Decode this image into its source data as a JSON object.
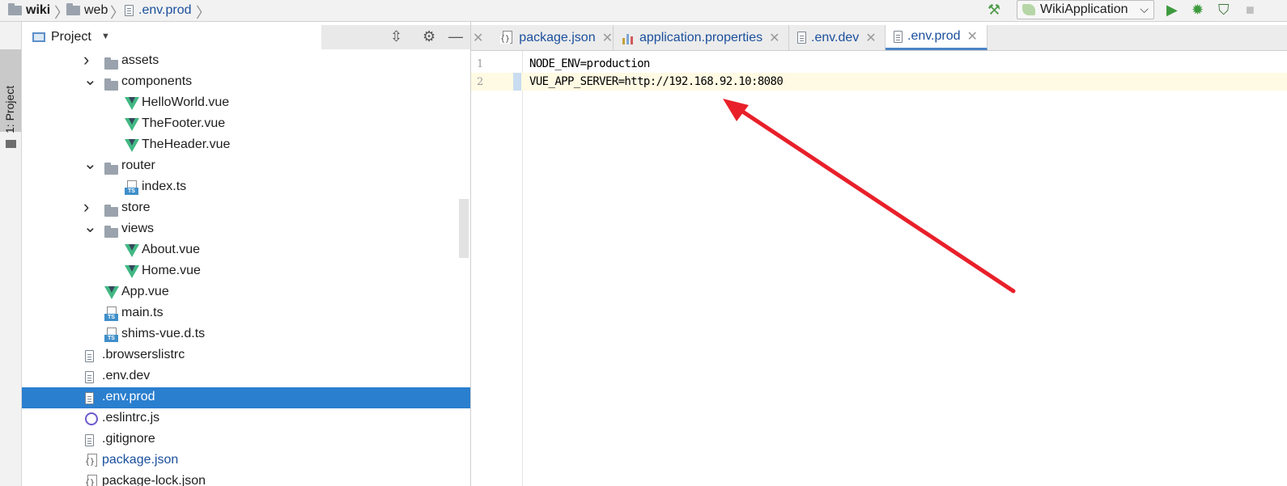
{
  "breadcrumbs": [
    {
      "label": "wiki",
      "icon": "folder-icon"
    },
    {
      "label": "web",
      "icon": "folder-icon"
    },
    {
      "label": ".env.prod",
      "icon": "file-icon"
    }
  ],
  "toolbar": {
    "run_config": "WikiApplication",
    "icons": [
      "hammer-icon",
      "run-icon",
      "debug-icon",
      "coverage-icon",
      "stop-icon"
    ]
  },
  "tool_stripe": {
    "project_tab": "1: Project"
  },
  "project_panel": {
    "title": "Project",
    "tree": [
      {
        "name": "assets",
        "type": "folder",
        "expanded": false,
        "depth": 1
      },
      {
        "name": "components",
        "type": "folder",
        "expanded": true,
        "depth": 1
      },
      {
        "name": "HelloWorld.vue",
        "type": "vue",
        "depth": 2
      },
      {
        "name": "TheFooter.vue",
        "type": "vue",
        "depth": 2
      },
      {
        "name": "TheHeader.vue",
        "type": "vue",
        "depth": 2
      },
      {
        "name": "router",
        "type": "folder",
        "expanded": true,
        "depth": 1
      },
      {
        "name": "index.ts",
        "type": "ts",
        "depth": 2
      },
      {
        "name": "store",
        "type": "folder",
        "expanded": false,
        "depth": 1
      },
      {
        "name": "views",
        "type": "folder",
        "expanded": true,
        "depth": 1
      },
      {
        "name": "About.vue",
        "type": "vue",
        "depth": 2
      },
      {
        "name": "Home.vue",
        "type": "vue",
        "depth": 2
      },
      {
        "name": "App.vue",
        "type": "vue",
        "depth": 1
      },
      {
        "name": "main.ts",
        "type": "ts",
        "depth": 1
      },
      {
        "name": "shims-vue.d.ts",
        "type": "ts",
        "depth": 1
      },
      {
        "name": ".browserslistrc",
        "type": "file",
        "depth": 0
      },
      {
        "name": ".env.dev",
        "type": "file",
        "depth": 0
      },
      {
        "name": ".env.prod",
        "type": "file",
        "depth": 0,
        "selected": true
      },
      {
        "name": ".eslintrc.js",
        "type": "eslint",
        "depth": 0
      },
      {
        "name": ".gitignore",
        "type": "file",
        "depth": 0
      },
      {
        "name": "package.json",
        "type": "json",
        "depth": 0,
        "modified": true
      },
      {
        "name": "package-lock.json",
        "type": "json",
        "depth": 0
      }
    ]
  },
  "tabs": [
    {
      "label": "package.json",
      "icon": "json-file-icon",
      "active": false
    },
    {
      "label": "application.properties",
      "icon": "properties-file-icon",
      "active": false
    },
    {
      "label": ".env.dev",
      "icon": "file-icon",
      "active": false
    },
    {
      "label": ".env.prod",
      "icon": "file-icon",
      "active": true
    }
  ],
  "editor": {
    "lines": [
      {
        "number": "1",
        "text": "NODE_ENV=production"
      },
      {
        "number": "2",
        "text": "VUE_APP_SERVER=http://192.168.92.10:8080"
      }
    ],
    "current_line": 2
  },
  "colors": {
    "selection": "#2a7fcf",
    "link_blue": "#1a4f9c",
    "vue_green": "#41b883",
    "annotation_arrow": "#e8202a",
    "current_line_bg": "#fffae3"
  }
}
